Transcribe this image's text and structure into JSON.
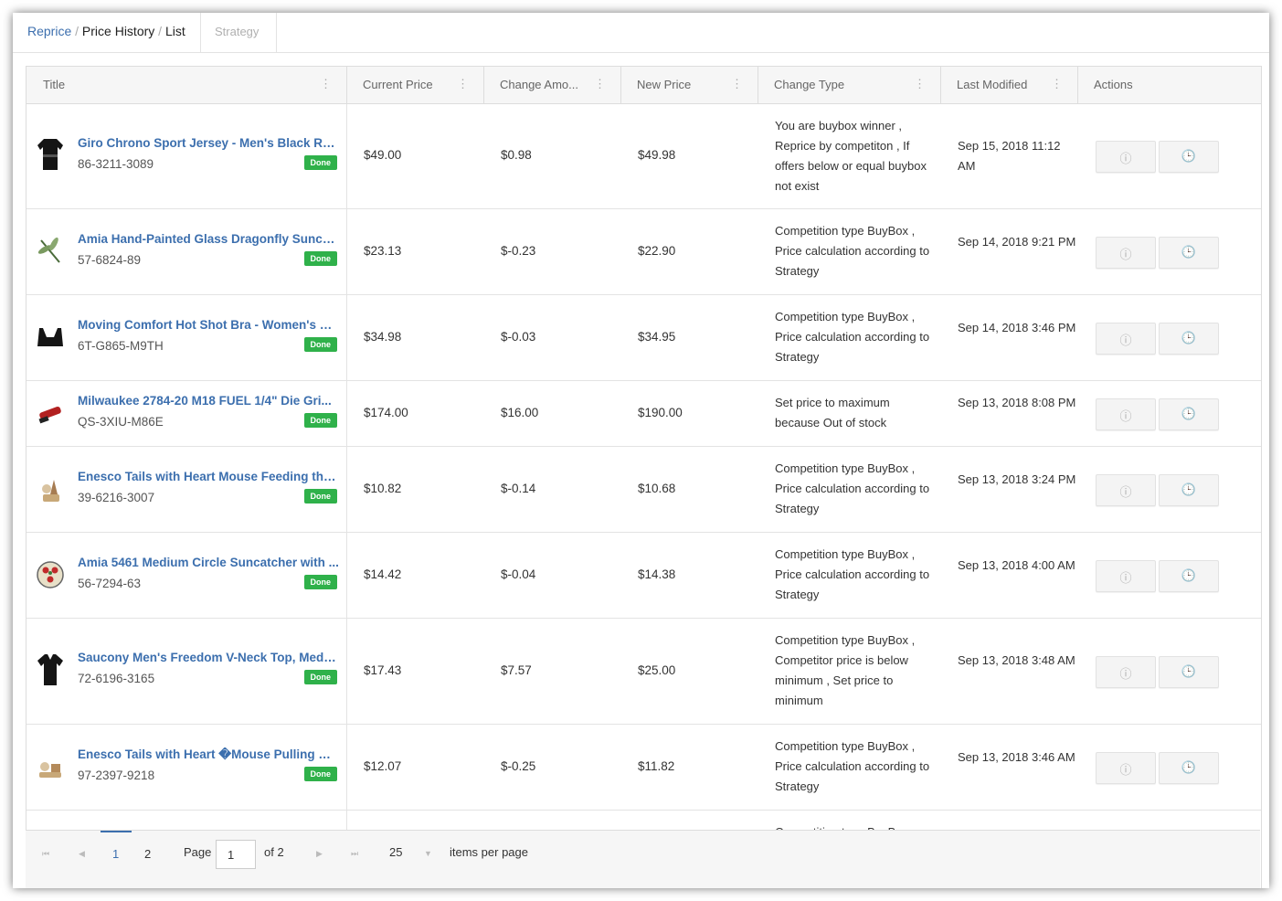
{
  "breadcrumb": {
    "root": "Reprice",
    "section": "Price History",
    "current": "List",
    "separator": "/"
  },
  "tabs": {
    "strategy": "Strategy"
  },
  "columns": [
    "Title",
    "Current Price",
    "Change Amo...",
    "New Price",
    "Change Type",
    "Last Modified",
    "Actions"
  ],
  "column_menu_icon": "⋮",
  "rows": [
    {
      "title": "Giro Chrono Sport Jersey - Men's Black Rop...",
      "sku": "86-3211-3089",
      "status": "Done",
      "current_price": "$49.00",
      "change_amount": "$0.98",
      "new_price": "$49.98",
      "change_type": "You are buybox winner , Reprice by competiton , If offers below or equal buybox not exist",
      "last_modified": "Sep 15, 2018 11:12 AM",
      "thumb": "jersey-icon"
    },
    {
      "title": "Amia Hand-Painted Glass Dragonfly Suncat...",
      "sku": "57-6824-89",
      "status": "Done",
      "current_price": "$23.13",
      "change_amount": "$-0.23",
      "new_price": "$22.90",
      "change_type": "Competition type BuyBox , Price calculation according to Strategy",
      "last_modified": "Sep 14, 2018 9:21 PM",
      "thumb": "dragonfly-icon"
    },
    {
      "title": "Moving Comfort Hot Shot Bra - Women's Bl...",
      "sku": "6T-G865-M9TH",
      "status": "Done",
      "current_price": "$34.98",
      "change_amount": "$-0.03",
      "new_price": "$34.95",
      "change_type": "Competition type BuyBox , Price calculation according to Strategy",
      "last_modified": "Sep 14, 2018 3:46 PM",
      "thumb": "bra-icon"
    },
    {
      "title": "Milwaukee 2784-20 M18 FUEL 1/4\" Die Gri...",
      "sku": "QS-3XIU-M86E",
      "status": "Done",
      "current_price": "$174.00",
      "change_amount": "$16.00",
      "new_price": "$190.00",
      "change_type": "Set price to maximum because Out of stock",
      "last_modified": "Sep 13, 2018 8:08 PM",
      "thumb": "grinder-icon"
    },
    {
      "title": "Enesco Tails with Heart Mouse Feeding the ...",
      "sku": "39-6216-3007",
      "status": "Done",
      "current_price": "$10.82",
      "change_amount": "$-0.14",
      "new_price": "$10.68",
      "change_type": "Competition type BuyBox , Price calculation according to Strategy",
      "last_modified": "Sep 13, 2018 3:24 PM",
      "thumb": "figurine-icon"
    },
    {
      "title": "Amia 5461 Medium Circle Suncatcher with ...",
      "sku": "56-7294-63",
      "status": "Done",
      "current_price": "$14.42",
      "change_amount": "$-0.04",
      "new_price": "$14.38",
      "change_type": "Competition type BuyBox , Price calculation according to Strategy",
      "last_modified": "Sep 13, 2018 4:00 AM",
      "thumb": "suncatcher-icon"
    },
    {
      "title": "Saucony Men's Freedom V-Neck Top, Mediu...",
      "sku": "72-6196-3165",
      "status": "Done",
      "current_price": "$17.43",
      "change_amount": "$7.57",
      "new_price": "$25.00",
      "change_type": "Competition type BuyBox , Competitor price is below minimum , Set price to minimum",
      "last_modified": "Sep 13, 2018 3:48 AM",
      "thumb": "tshirt-icon"
    },
    {
      "title": "Enesco Tails with Heart �Mouse Pulling W...",
      "sku": "97-2397-9218",
      "status": "Done",
      "current_price": "$12.07",
      "change_amount": "$-0.25",
      "new_price": "$11.82",
      "change_type": "Competition type BuyBox , Price calculation according to Strategy",
      "last_modified": "Sep 13, 2018 3:46 AM",
      "thumb": "figurine-icon"
    },
    {
      "change_type_partial": "Competition type BuyBox ,"
    }
  ],
  "actions": {
    "info_icon": "ⓘ",
    "history_icon": "🕒"
  },
  "pager": {
    "first_icon": "⏮",
    "prev_icon": "◀",
    "next_icon": "▶",
    "last_icon": "⏭",
    "pages": [
      "1",
      "2"
    ],
    "active_page": "1",
    "page_label": "Page",
    "page_value": "1",
    "of_label": "of 2",
    "page_size": "25",
    "dropdown_icon": "▼",
    "items_per_page": "items per page"
  },
  "colors": {
    "link": "#3c6fae",
    "done_badge": "#2fb14a",
    "header_bg": "#f6f6f6"
  }
}
